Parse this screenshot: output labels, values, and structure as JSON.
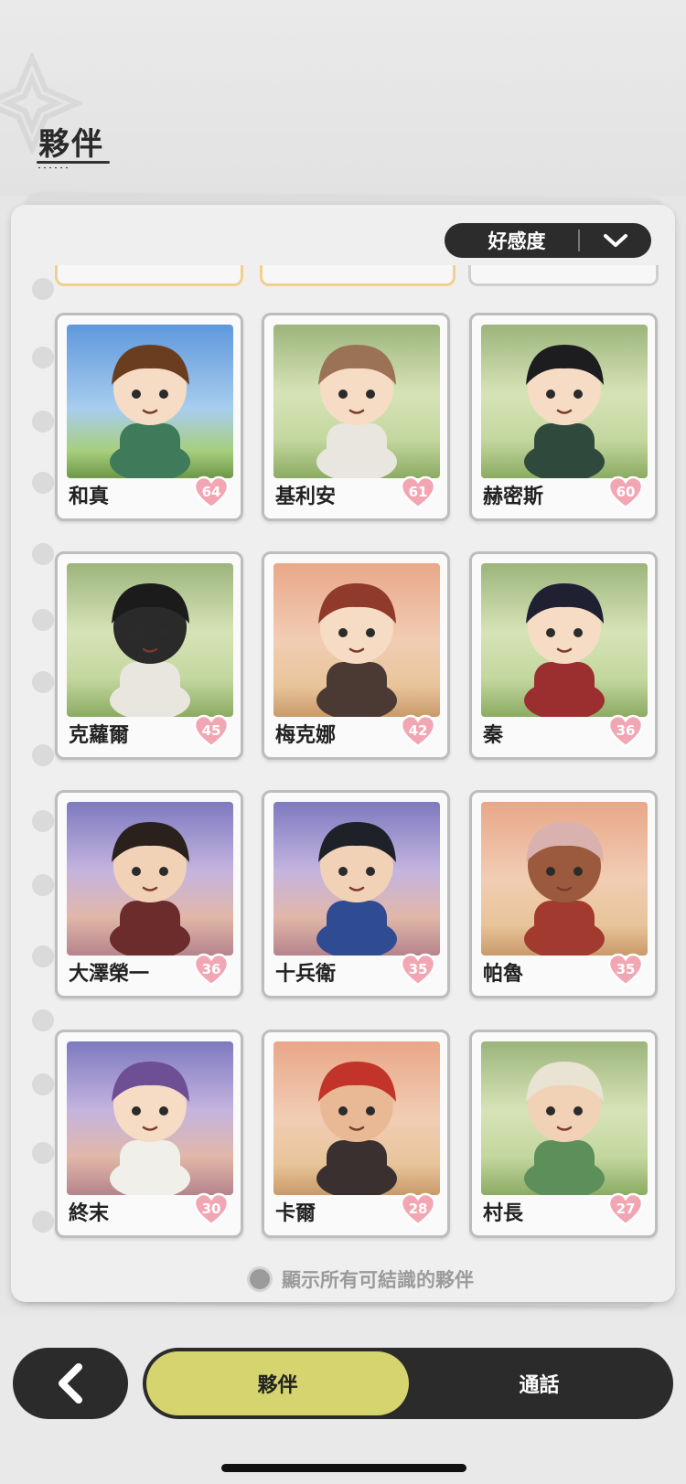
{
  "header": {
    "title": "夥伴"
  },
  "sort": {
    "label": "好感度"
  },
  "companions": [
    {
      "name": "和真",
      "affection": "64",
      "bg": "sky",
      "hair": "#6b3d1f",
      "skin": "#f6dcc4",
      "outfit": "#3f7a5a"
    },
    {
      "name": "基利安",
      "affection": "61",
      "bg": "forest",
      "hair": "#9b7256",
      "skin": "#f6dcc4",
      "outfit": "#e9e6df"
    },
    {
      "name": "赫密斯",
      "affection": "60",
      "bg": "forest",
      "hair": "#1d1d1f",
      "skin": "#f6dcc4",
      "outfit": "#2f4a3d"
    },
    {
      "name": "克蘿爾",
      "affection": "45",
      "bg": "forest",
      "hair": "#1b1b1b",
      "skin": "#2a2a2a",
      "outfit": "#e9e6df"
    },
    {
      "name": "梅克娜",
      "affection": "42",
      "bg": "desert",
      "hair": "#8f3a2a",
      "skin": "#f6dcc4",
      "outfit": "#4a3a33"
    },
    {
      "name": "秦",
      "affection": "36",
      "bg": "forest",
      "hair": "#1f2133",
      "skin": "#f6dcc4",
      "outfit": "#9b2f2f"
    },
    {
      "name": "大澤榮一",
      "affection": "36",
      "bg": "dusk",
      "hair": "#2a211d",
      "skin": "#f2d2b6",
      "outfit": "#6d2c2c"
    },
    {
      "name": "十兵衛",
      "affection": "35",
      "bg": "dusk",
      "hair": "#1e2228",
      "skin": "#f2d2b6",
      "outfit": "#2f4c92"
    },
    {
      "name": "帕魯",
      "affection": "35",
      "bg": "desert",
      "hair": "#d9b1ae",
      "skin": "#9b5a3e",
      "outfit": "#a23a2f"
    },
    {
      "name": "終末",
      "affection": "30",
      "bg": "dusk",
      "hair": "#6e4e95",
      "skin": "#f6dcc4",
      "outfit": "#f1efe9"
    },
    {
      "name": "卡爾",
      "affection": "28",
      "bg": "desert",
      "hair": "#c2342a",
      "skin": "#e9b995",
      "outfit": "#3a3030"
    },
    {
      "name": "村長",
      "affection": "27",
      "bg": "forest",
      "hair": "#e8e3d2",
      "skin": "#f2d2b6",
      "outfit": "#5c8f5a"
    }
  ],
  "show_all": {
    "label": "顯示所有可結識的夥伴"
  },
  "nav": {
    "tab_companions": "夥伴",
    "tab_calls": "通話"
  },
  "colors": {
    "heart": "#f2a6b3",
    "active_tab": "#d5d46f",
    "nav_dark": "#2b2b2b"
  }
}
